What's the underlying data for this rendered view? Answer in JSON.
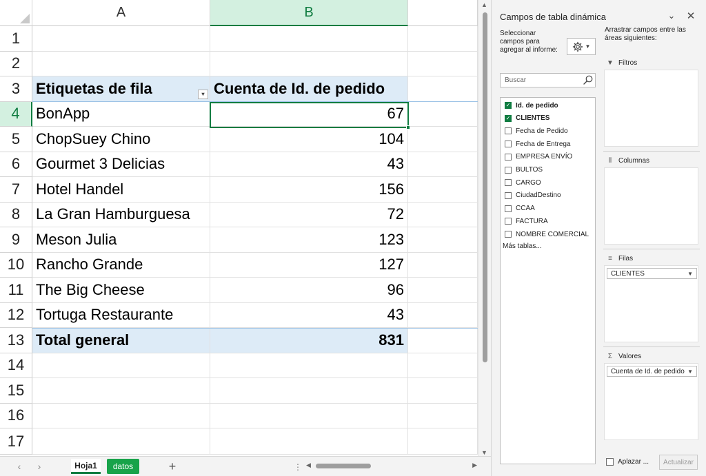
{
  "sheet": {
    "columns": [
      "A",
      "B"
    ],
    "row_numbers": [
      "1",
      "2",
      "3",
      "4",
      "5",
      "6",
      "7",
      "8",
      "9",
      "10",
      "11",
      "12",
      "13",
      "14",
      "15",
      "16",
      "17"
    ],
    "pivot": {
      "header_row_label": "Etiquetas de fila",
      "header_value_label": "Cuenta de Id. de pedido",
      "rows": [
        {
          "label": "BonApp",
          "value": "67"
        },
        {
          "label": "ChopSuey Chino",
          "value": "104"
        },
        {
          "label": "Gourmet 3 Delicias",
          "value": "43"
        },
        {
          "label": "Hotel Handel",
          "value": "156"
        },
        {
          "label": "La Gran Hamburguesa",
          "value": "72"
        },
        {
          "label": "Meson Julia",
          "value": "123"
        },
        {
          "label": "Rancho Grande",
          "value": "127"
        },
        {
          "label": "The Big Cheese",
          "value": "96"
        },
        {
          "label": "Tortuga Restaurante",
          "value": "43"
        }
      ],
      "total_label": "Total general",
      "total_value": "831"
    },
    "selected_cell": "B4",
    "tabs": [
      {
        "label": "Hoja1",
        "active": true
      },
      {
        "label": "datos",
        "active": false
      }
    ],
    "add_sheet": "+",
    "nav_prev": "‹",
    "nav_next": "›",
    "tab_separator": "⋮"
  },
  "pane": {
    "title": "Campos de tabla dinámica",
    "chevron": "⌄",
    "close": "✕",
    "select_desc": "Seleccionar campos para agregar al informe:",
    "search_placeholder": "Buscar",
    "fields": [
      {
        "label": "Id. de pedido",
        "checked": true
      },
      {
        "label": "CLIENTES",
        "checked": true
      },
      {
        "label": "Fecha de Pedido",
        "checked": false
      },
      {
        "label": "Fecha de Entrega",
        "checked": false
      },
      {
        "label": "EMPRESA ENVÍO",
        "checked": false
      },
      {
        "label": "BULTOS",
        "checked": false
      },
      {
        "label": "CARGO",
        "checked": false
      },
      {
        "label": "CiudadDestino",
        "checked": false
      },
      {
        "label": "CCAA",
        "checked": false
      },
      {
        "label": "FACTURA",
        "checked": false
      },
      {
        "label": "NOMBRE COMERCIAL",
        "checked": false
      }
    ],
    "more_tables": "Más tablas...",
    "areas_desc": "Arrastrar campos entre las áreas siguientes:",
    "areas": {
      "filters": {
        "label": "Filtros",
        "items": []
      },
      "columns": {
        "label": "Columnas",
        "items": []
      },
      "rows": {
        "label": "Filas",
        "items": [
          "CLIENTES"
        ]
      },
      "values": {
        "label": "Valores",
        "items": [
          "Cuenta de Id. de pedido"
        ]
      }
    },
    "defer_label": "Aplazar ...",
    "update_label": "Actualizar"
  },
  "colors": {
    "accent": "#107c41",
    "pivot_header_fill": "#ddebf7",
    "datos_tab": "#18a34a"
  },
  "icons": {
    "gear": "gear-icon",
    "search": "search-icon",
    "filter": "filter-icon",
    "columns": "columns-icon",
    "rows": "rows-icon",
    "sigma": "sigma-icon"
  }
}
